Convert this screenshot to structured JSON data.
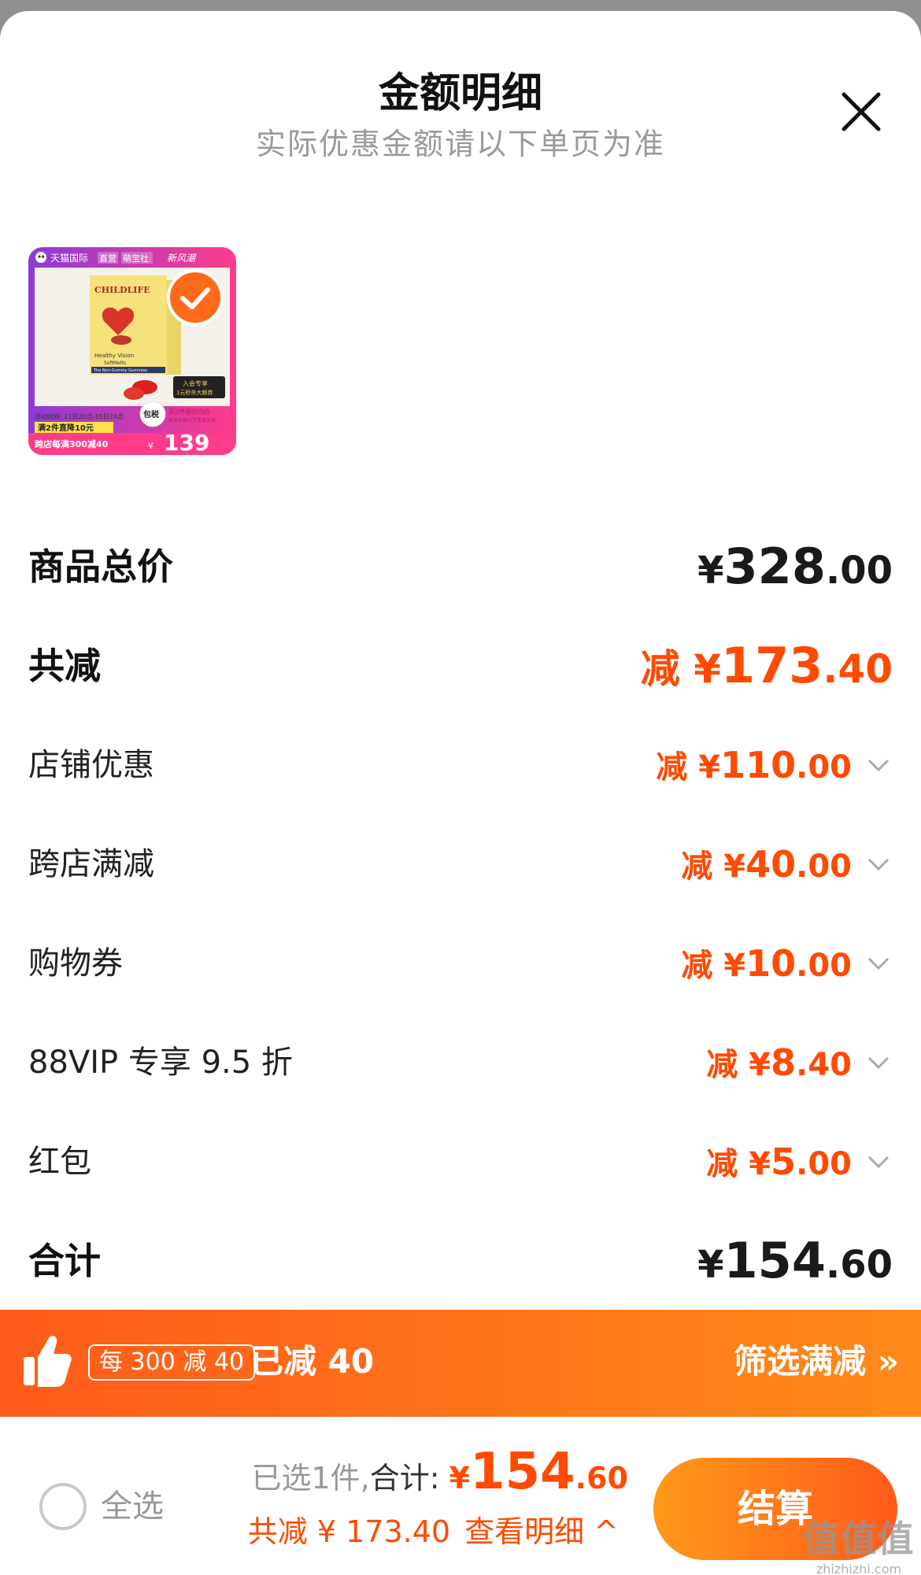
{
  "header": {
    "title": "金额明细",
    "subtitle": "实际优惠金额请以下单页为准"
  },
  "product": {
    "platform": "天猫国际",
    "tags": [
      "直营",
      "萌宝社",
      "新风潮"
    ],
    "brand": "CHILDLIFE",
    "name_line1": "Healthy Vision",
    "name_line2": "SoftMelts",
    "name_line3": "The Non-Gummy Gummies",
    "activity_time": "活动时间: 11日20点-15日24点",
    "promo_line1": "满2件直降10元",
    "promo_line2": "跨店每满300减40",
    "member_tag_line1": "入会专享",
    "member_tag_line2": "1元秒杀大额券",
    "est_label": "买2件预估均价",
    "est_note": "具体价格以下单页为准",
    "tax_badge": "包税",
    "price_currency": "¥",
    "price": "139"
  },
  "rows": [
    {
      "label": "商品总价",
      "prefix": "",
      "currency": "¥",
      "int": "328",
      "dec": ".00"
    },
    {
      "label": "共减",
      "prefix": "减 ",
      "currency": "¥",
      "int": "173",
      "dec": ".40"
    },
    {
      "label": "店铺优惠",
      "prefix": "减 ",
      "currency": "¥",
      "int": "110",
      "dec": ".00"
    },
    {
      "label": "跨店满减",
      "prefix": "减 ",
      "currency": "¥",
      "int": "40",
      "dec": ".00"
    },
    {
      "label": "购物券",
      "prefix": "减 ",
      "currency": "¥",
      "int": "10",
      "dec": ".00"
    },
    {
      "label": "88VIP 专享 9.5 折",
      "prefix": "减 ",
      "currency": "¥",
      "int": "8",
      "dec": ".40"
    },
    {
      "label": "红包",
      "prefix": "减 ",
      "currency": "¥",
      "int": "5",
      "dec": ".00"
    },
    {
      "label": "合计",
      "prefix": "",
      "currency": "¥",
      "int": "154",
      "dec": ".60"
    }
  ],
  "promo_bar": {
    "badge": "每 300 减 40",
    "text": "已减 40",
    "link": "筛选满减 »"
  },
  "bottom": {
    "select_all": "全选",
    "selected_label": "已选1件,",
    "total_label": "合计: ",
    "total_currency": "¥",
    "total_int": "154",
    "total_dec": ".60",
    "discount_text": "共减 ¥ 173.40",
    "view_detail": "查看明细 ^",
    "checkout": "结算"
  },
  "watermark": {
    "big": "值值值",
    "small": "zhizhizhi.com"
  },
  "colors": {
    "accent": "#ff4a00",
    "promo_gradient_start": "#ff5a1a",
    "promo_gradient_end": "#ff8a1a"
  }
}
